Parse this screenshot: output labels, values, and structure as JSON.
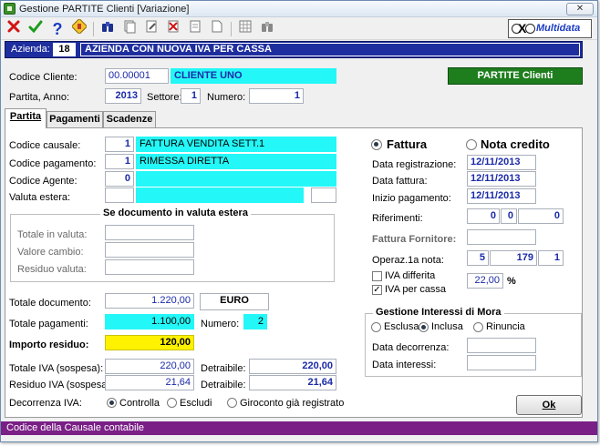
{
  "window": {
    "title": "Gestione PARTITE Clienti [Variazione]",
    "close_glyph": "✕"
  },
  "toolbar": {
    "icons": [
      "close-x-icon",
      "confirm-check-icon",
      "help-icon",
      "calculator-icon",
      "binoculars-icon",
      "copy-page-icon",
      "edit-page-icon",
      "delete-page-icon",
      "page-icon",
      "blank-page-icon",
      "grid-icon",
      "binoculars-gray-icon"
    ],
    "brand": "Multidata",
    "brand_x": "X"
  },
  "azienda": {
    "label": "Azienda:",
    "code": "18",
    "name": "AZIENDA CON NUOVA IVA PER CASSA"
  },
  "header": {
    "codice_cliente_label": "Codice Cliente:",
    "codice_cliente": "00.00001",
    "cliente_name": "CLIENTE UNO",
    "partite_button": "PARTITE Clienti",
    "partita_anno_label": "Partita, Anno:",
    "anno": "2013",
    "settore_label": "Settore:",
    "settore": "1",
    "numero_label": "Numero:",
    "numero": "1"
  },
  "tabs": [
    {
      "label": "Partita",
      "active": true
    },
    {
      "label": "Pagamenti",
      "active": false
    },
    {
      "label": "Scadenze",
      "active": false
    }
  ],
  "partita": {
    "causale_label": "Codice causale:",
    "causale_code": "1",
    "causale_desc": "FATTURA VENDITA SETT.1",
    "pagamento_label": "Codice pagamento:",
    "pagamento_code": "1",
    "pagamento_desc": "RIMESSA DIRETTA",
    "agente_label": "Codice Agente:",
    "agente_code": "0",
    "agente_desc": "",
    "valuta_label": "Valuta estera:",
    "valuta_code": "",
    "valuta_desc": "",
    "valuta_extra": "",
    "valuta_group_title": "Se documento in valuta estera",
    "totale_valuta_label": "Totale in valuta:",
    "totale_valuta": "",
    "valore_cambio_label": "Valore cambio:",
    "valore_cambio": "",
    "residuo_valuta_label": "Residuo valuta:",
    "residuo_valuta": "",
    "totale_documento_label": "Totale documento:",
    "totale_documento": "1.220,00",
    "currency": "EURO",
    "totale_pagamenti_label": "Totale pagamenti:",
    "totale_pagamenti": "1.100,00",
    "numero_pag_label": "Numero:",
    "numero_pag": "2",
    "importo_residuo_label": "Importo residuo:",
    "importo_residuo": "120,00",
    "totale_iva_label": "Totale IVA (sospesa):",
    "totale_iva": "220,00",
    "detraibile_label": "Detraibile:",
    "detraibile_1": "220,00",
    "residuo_iva_label": "Residuo IVA (sospesa):",
    "residuo_iva": "21,64",
    "detraibile_2": "21,64",
    "decorrenza_label": "Decorrenza IVA:",
    "decorrenza_options": [
      {
        "label": "Controlla",
        "selected": true
      },
      {
        "label": "Escludi",
        "selected": false
      },
      {
        "label": "Giroconto già registrato",
        "selected": false
      }
    ]
  },
  "documento": {
    "types": [
      {
        "label": "Fattura",
        "selected": true
      },
      {
        "label": "Nota credito",
        "selected": false
      }
    ],
    "data_registrazione_label": "Data registrazione:",
    "data_registrazione": "12/11/2013",
    "data_fattura_label": "Data fattura:",
    "data_fattura": "12/11/2013",
    "inizio_pagamento_label": "Inizio pagamento:",
    "inizio_pagamento": "12/11/2013",
    "riferimenti_label": "Riferimenti:",
    "riferimenti": [
      "0",
      "0",
      "0"
    ],
    "fattura_fornitore_label": "Fattura Fornitore:",
    "fattura_fornitore": "",
    "operaz_label": "Operaz.1a nota:",
    "operaz": [
      "5",
      "179",
      "1"
    ],
    "iva_differita_label": "IVA differita",
    "iva_differita": false,
    "iva_per_cassa_label": "IVA per cassa",
    "iva_per_cassa": true,
    "iva_percent": "22,00",
    "percent_sign": "%"
  },
  "mora": {
    "title": "Gestione Interessi di Mora",
    "options": [
      {
        "label": "Esclusa",
        "selected": false
      },
      {
        "label": "Inclusa",
        "selected": true
      },
      {
        "label": "Rinuncia",
        "selected": false
      }
    ],
    "data_decorrenza_label": "Data decorrenza:",
    "data_decorrenza": "",
    "data_interessi_label": "Data interessi:",
    "data_interessi": ""
  },
  "ok_label": "Ok",
  "status": "Codice della Causale contabile",
  "colors": {
    "accent_blue": "#1e2e9e",
    "cyan": "#24f7f7",
    "yellow": "#fff200",
    "green": "#1e7e1e",
    "status_purple": "#7a1f86"
  }
}
